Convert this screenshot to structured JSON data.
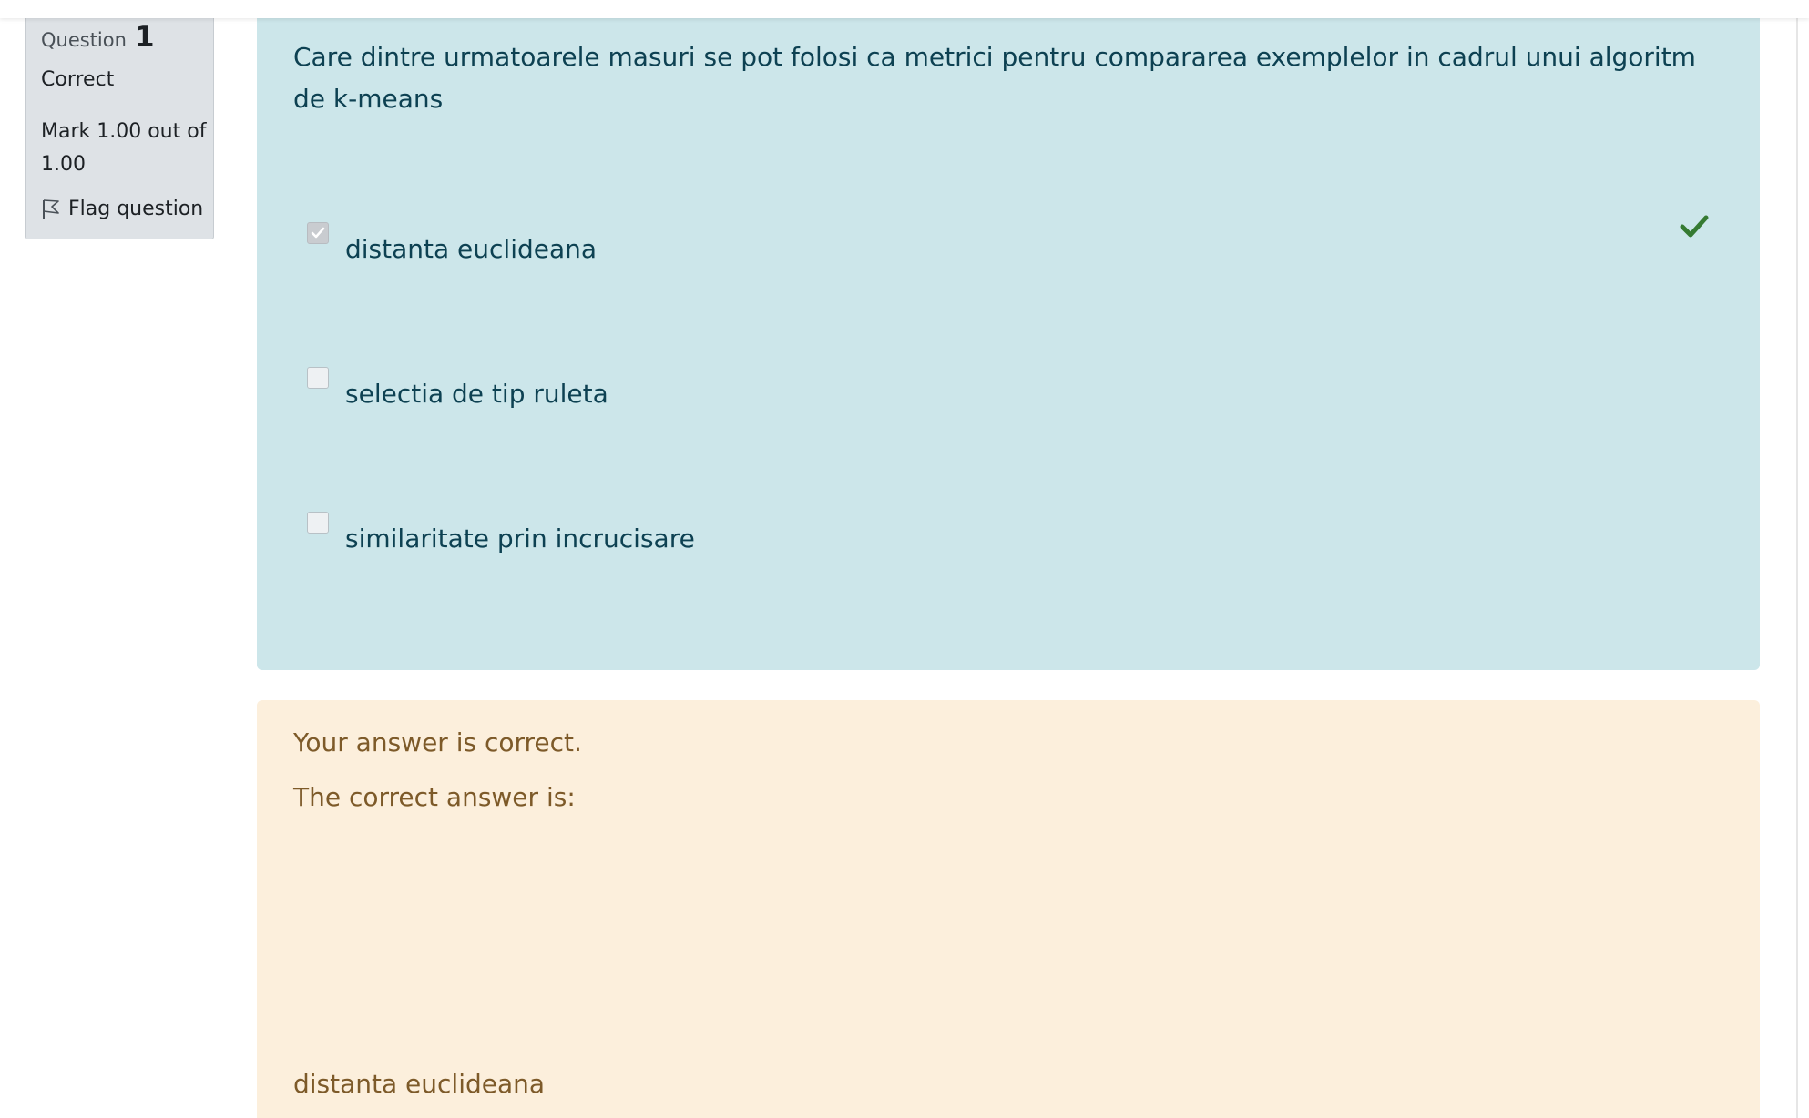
{
  "info": {
    "question_label": "Question",
    "question_number": "1",
    "state": "Correct",
    "grade": "Mark 1.00 out of 1.00",
    "flag_label": "Flag question"
  },
  "question": {
    "text": "Care dintre urmatoarele masuri se pot folosi ca metrici pentru compararea exemplelor in cadrul unui algoritm de k-means",
    "options": [
      {
        "label": "distanta euclideana",
        "checked": true,
        "correct": true
      },
      {
        "label": "selectia de tip ruleta",
        "checked": false
      },
      {
        "label": "similaritate prin incrucisare",
        "checked": false
      }
    ]
  },
  "feedback": {
    "specific": "Your answer is correct.",
    "right_answer_intro": "The correct answer is:",
    "right_answer": "distanta euclideana"
  },
  "colors": {
    "formulation_bg": "#cce6ea",
    "feedback_bg": "#fcefdc",
    "correct_green": "#357a32"
  }
}
